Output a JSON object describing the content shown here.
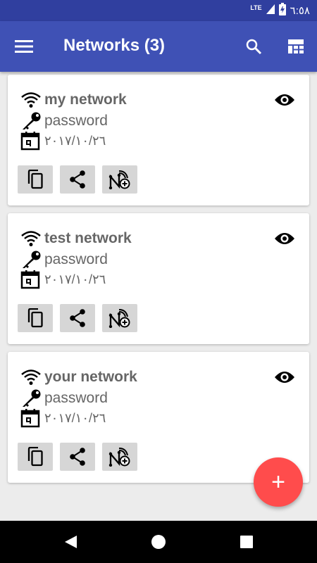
{
  "status_bar": {
    "network": "LTE",
    "time": "٦:٥٨"
  },
  "app_bar": {
    "title": "Networks (3)"
  },
  "networks": [
    {
      "name": "my network",
      "password": "password",
      "date": "٢٠١٧/١٠/٢٦"
    },
    {
      "name": "test network",
      "password": "password",
      "date": "٢٠١٧/١٠/٢٦"
    },
    {
      "name": "your network",
      "password": "password",
      "date": "٢٠١٧/١٠/٢٦"
    }
  ],
  "fab": {
    "label": "+"
  },
  "colors": {
    "primary": "#3f51b5",
    "primary_dark": "#303f9f",
    "accent": "#ff4c4c",
    "action_bg": "#d6d6d6"
  },
  "icons": [
    "menu-icon",
    "search-icon",
    "layout-icon",
    "wifi-icon",
    "key-icon",
    "calendar-icon",
    "eye-icon",
    "copy-icon",
    "share-icon",
    "nfc-add-icon",
    "back-icon",
    "home-icon",
    "recents-icon"
  ]
}
